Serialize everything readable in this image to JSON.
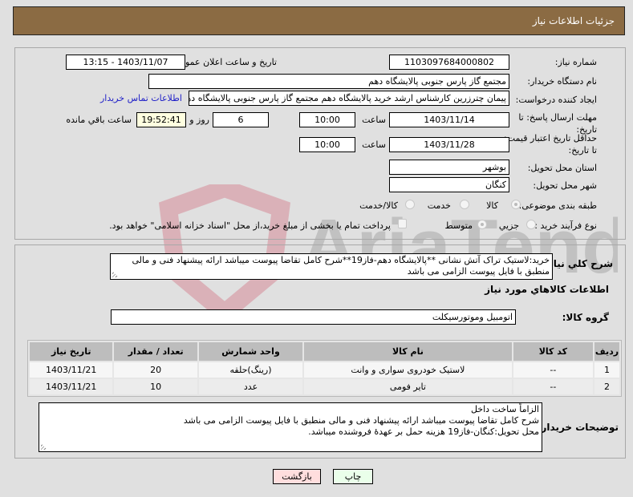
{
  "header": {
    "title": "جزئیات اطلاعات نیاز"
  },
  "details": {
    "need_number_label": "شماره نیاز:",
    "need_number": "1103097684000802",
    "announce_label": "تاریخ و ساعت اعلان عمومی:",
    "announce_value": "1403/11/07 - 13:15",
    "buyer_org_label": "نام دستگاه خریدار:",
    "buyer_org": "مجتمع گاز پارس جنوبی  پالایشگاه دهم",
    "requester_label": "ایجاد کننده درخواست:",
    "requester": "پیمان چترزرین کارشناس ارشد خرید پالایشگاه دهم مجتمع گاز پارس جنوبی  پالایشگاه دهم",
    "contact_link": "اطلاعات تماس خریدار",
    "reply_deadline_label": "مهلت ارسال پاسخ: تا تاریخ:",
    "reply_date": "1403/11/14",
    "time_label": "ساعت",
    "reply_time": "10:00",
    "days_value": "6",
    "days_label": "روز و",
    "remaining_time": "19:52:41",
    "remaining_label": "ساعت باقي مانده",
    "price_valid_label": "حداقل تاریخ اعتبار قیمت: تا تاریخ:",
    "price_valid_date": "1403/11/28",
    "price_valid_time": "10:00",
    "province_label": "استان محل تحویل:",
    "province": "بوشهر",
    "city_label": "شهر محل تحویل:",
    "city": "کنگان",
    "category_label": "طبقه بندی موضوعی:",
    "category_options": [
      {
        "label": "کالا",
        "selected": true
      },
      {
        "label": "خدمت",
        "selected": false
      },
      {
        "label": "کالا/خدمت",
        "selected": false
      }
    ],
    "process_label": "نوع فرآیند خرید :",
    "process_options": [
      {
        "label": "جزیي",
        "selected": false
      },
      {
        "label": "متوسط",
        "selected": true
      }
    ],
    "treasury_checkbox_label": "پرداخت تمام یا بخشی از مبلغ خرید،از محل \"اسناد خزانه اسلامی\" خواهد بود.",
    "treasury_checked": false
  },
  "summary": {
    "label": "شرح كلي نياز:",
    "text": "خرید:لاستیک تراک آتش نشانی **پالایشگاه دهم-فاز19**شرح کامل تقاضا پیوست میباشد ارائه پیشنهاد فنی و مالی منطبق با فایل پیوست الزامی می باشد"
  },
  "goods": {
    "section_title": "اطلاعات كالاهاي مورد نياز",
    "group_label": "گروه كالا:",
    "group_value": "اتومبیل وموتورسیکلت",
    "columns": [
      "رديف",
      "كد كالا",
      "نام كالا",
      "واحد شمارش",
      "تعداد / مقدار",
      "تاریخ نیاز"
    ],
    "rows": [
      {
        "index": "1",
        "code": "--",
        "name": "لاستیک خودروی سواری و وانت",
        "unit": "(رینگ)حلقه",
        "qty": "20",
        "date": "1403/11/21"
      },
      {
        "index": "2",
        "code": "--",
        "name": "تایر فومی",
        "unit": "عدد",
        "qty": "10",
        "date": "1403/11/21"
      }
    ]
  },
  "buyer_notes": {
    "label": "توضیحات خریدار:",
    "lines": [
      "الزاماً ساخت داخل",
      "شرح کامل تقاضا پیوست میباشد ارائه پیشنهاد فنی و مالی منطبق با فایل پیوست الزامی می باشد",
      "محل تحویل:کنگان-فاز19 هزینه حمل بر عهدهٔ فروشنده میباشد."
    ]
  },
  "buttons": {
    "print": "چاپ",
    "back": "بازگشت"
  },
  "watermark": {
    "text": "AriaTender.neT"
  },
  "colors": {
    "header_bg": "#8b6b43",
    "link": "#2121c8",
    "back_btn_bg": "#ffdede",
    "print_btn_bg": "#eaffea",
    "remaining_bg": "#ffffe0"
  }
}
